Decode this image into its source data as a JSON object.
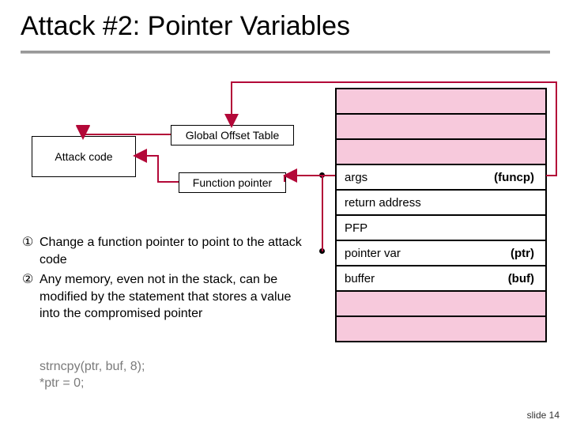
{
  "title": "Attack #2: Pointer Variables",
  "boxes": {
    "attack_code": "Attack code",
    "got": "Global Offset Table",
    "funcptr": "Function pointer"
  },
  "stack": {
    "rows": [
      {
        "left": "",
        "right": "",
        "filled": false
      },
      {
        "left": "",
        "right": "",
        "filled": false
      },
      {
        "left": "",
        "right": "",
        "filled": false
      },
      {
        "left": "args",
        "right": "(funcp)",
        "filled": true
      },
      {
        "left": "return address",
        "right": "",
        "filled": true
      },
      {
        "left": "PFP",
        "right": "",
        "filled": true
      },
      {
        "left": "pointer var",
        "right": "(ptr)",
        "filled": true
      },
      {
        "left": "buffer",
        "right": "(buf)",
        "filled": true
      },
      {
        "left": "",
        "right": "",
        "filled": false
      },
      {
        "left": "",
        "right": "",
        "filled": false
      }
    ]
  },
  "body": {
    "items": [
      {
        "num": "①",
        "text": "Change a function pointer to point to the attack code"
      },
      {
        "num": "②",
        "text": "Any memory, even not in the stack, can be modified by the statement that stores a value into the compromised pointer"
      }
    ]
  },
  "code": {
    "line1": "strncpy(ptr, buf, 8);",
    "line2": "*ptr = 0;"
  },
  "slide": "slide 14",
  "colors": {
    "arrow": "#b30838",
    "stack_empty": "#f7c9dc"
  }
}
